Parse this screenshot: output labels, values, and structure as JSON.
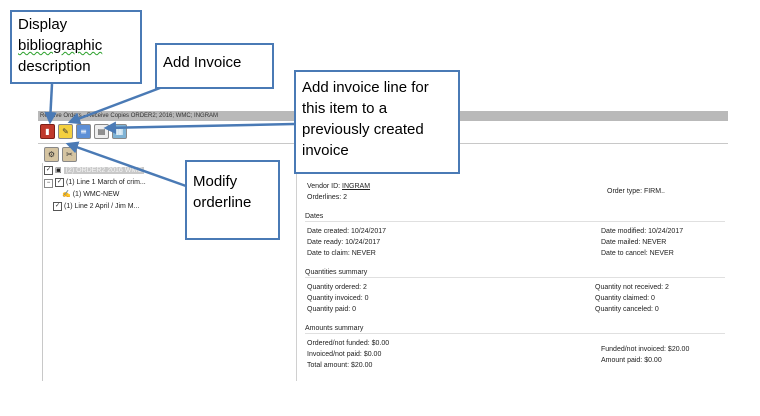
{
  "app": {
    "title": "Receive Orders - Receive Copies  ORDER2; 2016; WMC; INGRAM",
    "toolbar1": [
      {
        "name": "bib-description-icon",
        "glyph": "▮",
        "style": "book"
      },
      {
        "name": "add-invoice-icon",
        "glyph": "✎",
        "style": "inv"
      },
      {
        "name": "add-invoice-line-icon",
        "glyph": "≡",
        "style": "line"
      },
      {
        "name": "invoice-doc-icon",
        "glyph": "▤",
        "style": "doc"
      },
      {
        "name": "card-icon",
        "glyph": "▦",
        "style": "card"
      }
    ],
    "toolbar2": [
      {
        "name": "modify-orderline-icon",
        "glyph": "⚙",
        "style": "tool"
      },
      {
        "name": "orderline-tool-icon",
        "glyph": "✂",
        "style": "tool"
      }
    ],
    "tree": {
      "root": "(2) ORDER2 2016 WMC",
      "line1": "(1) Line 1 March of crim...",
      "line1_child": "(1) WMC-NEW",
      "line2": "(1) Line 2 April / Jim M..."
    },
    "detail": {
      "vendor_label": "Vendor ID:",
      "vendor_value": "INGRAM",
      "orderlines": "Orderlines: 2",
      "order_type": "Order type: FIRM..",
      "dates_title": "Dates",
      "date_created": "Date created: 10/24/2017",
      "date_ready": "Date ready:    10/24/2017",
      "date_to_claim": "Date to claim: NEVER",
      "date_modified": "Date modified:  10/24/2017",
      "date_mailed": "Date mailed:     NEVER",
      "date_to_cancel": "Date to cancel: NEVER",
      "quantities_title": "Quantities summary",
      "qty_ordered": "Quantity ordered: 2",
      "qty_invoiced": "Quantity invoiced: 0",
      "qty_paid": "Quantity paid:      0",
      "qty_not_received": "Quantity not received: 2",
      "qty_claimed": "Quantity claimed:       0",
      "qty_canceled": "Quantity canceled:      0",
      "amounts_title": "Amounts summary",
      "ordered_not_funded": "Ordered/not funded: $0.00",
      "invoiced_not_paid": "Invoiced/not paid:    $0.00",
      "total_amount": "Total amount:        $20.00",
      "funded_not_invoiced": "Funded/not invoiced: $20.00",
      "amount_paid": "Amount paid:              $0.00"
    }
  },
  "callouts": {
    "display_bib_line1": "Display",
    "display_bib_line2": "bibliographic",
    "display_bib_line3": "description",
    "add_invoice": "Add Invoice",
    "add_line_1": "Add invoice line for",
    "add_line_2": "this item to a",
    "add_line_3": "previously created",
    "add_line_4": "invoice",
    "modify_1": "Modify",
    "modify_2": "orderline"
  },
  "colors": {
    "callout_border": "#4a7ab5",
    "arrow": "#4a7ab5"
  }
}
